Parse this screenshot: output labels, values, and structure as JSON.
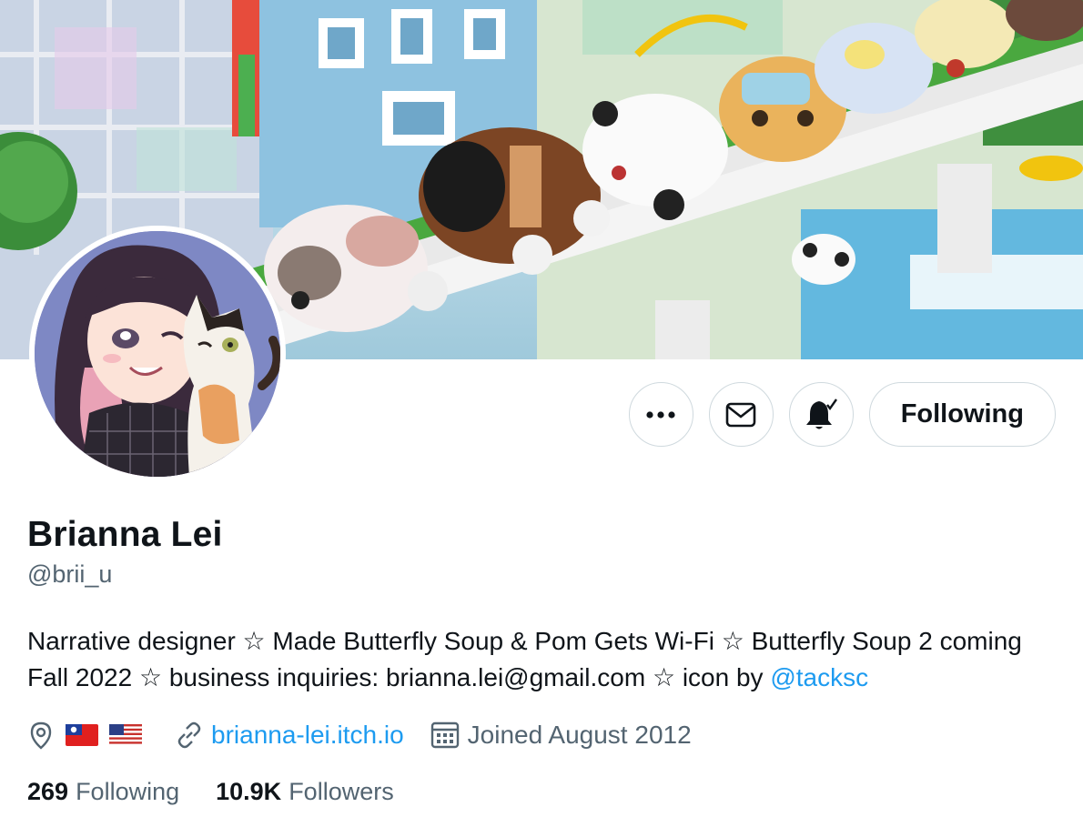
{
  "profile": {
    "name": "Brianna Lei",
    "handle": "@brii_u",
    "bio_text": "Narrative designer ☆ Made Butterfly Soup & Pom Gets Wi-Fi ☆ Butterfly Soup 2 coming Fall 2022 ☆ business inquiries: brianna.lei@gmail.com ☆ icon by ",
    "bio_mention": "@tacksc",
    "website": "brianna-lei.itch.io",
    "joined": "Joined August 2012",
    "location_flags": [
      "taiwan-flag",
      "us-flag"
    ]
  },
  "actions": {
    "more_icon": "more-icon",
    "message_icon": "mail-icon",
    "notify_icon": "bell-check-icon",
    "follow_label": "Following"
  },
  "stats": {
    "following_count": "269",
    "following_label": "Following",
    "followers_count": "10.9K",
    "followers_label": "Followers"
  },
  "colors": {
    "accent": "#1d9bf0",
    "text": "#0f1419",
    "secondary": "#536471",
    "border": "#cfd9de"
  }
}
